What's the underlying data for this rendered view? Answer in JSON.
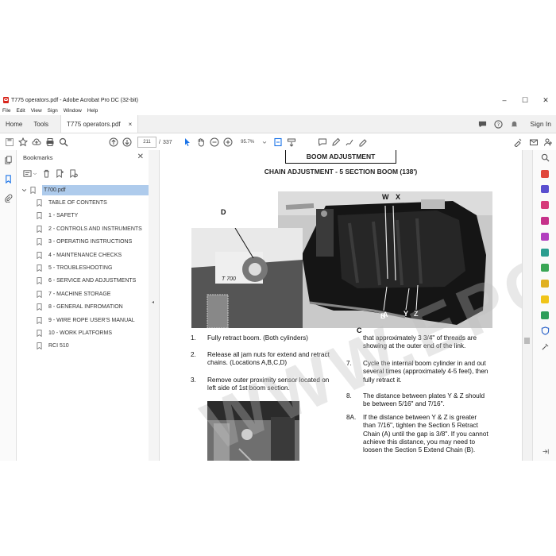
{
  "window": {
    "title": "T775 operators.pdf - Adobe Acrobat Pro DC (32-bit)",
    "controls": [
      "–",
      "☐",
      "✕"
    ]
  },
  "menu": [
    "File",
    "Edit",
    "View",
    "Sign",
    "Window",
    "Help"
  ],
  "tabs": {
    "home": "Home",
    "tools": "Tools",
    "doc": "T775 operators.pdf",
    "doc_close": "×",
    "signin": "Sign In"
  },
  "toolbar": {
    "page_current": "211",
    "page_sep": "/",
    "page_total": "337",
    "zoom": "95.7%"
  },
  "bookmarks": {
    "title": "Bookmarks",
    "close": "✕",
    "root": "T700.pdf",
    "items": [
      "TABLE OF CONTENTS",
      "1 - SAFETY",
      "2 - CONTROLS AND INSTRUMENTS",
      "3 - OPERATING INSTRUCTIONS",
      "4 - MAINTENANCE CHECKS",
      "5 - TROUBLESHOOTING",
      "6 - SERVICE AND ADJUSTMENTS",
      "7 - MACHINE STORAGE",
      "8 - GENERAL INFROMATION",
      "9 - WIRE ROPE USER'S MANUAL",
      "10 - WORK PLATFORMS",
      "RCI 510"
    ]
  },
  "page": {
    "header": "BOOM ADJUSTMENT",
    "subtitle": "CHAIN ADJUSTMENT - 5 SECTION BOOM (138')",
    "labels": {
      "d": "D",
      "w": "W",
      "x": "X",
      "a": "A",
      "b": "B",
      "c": "C",
      "y": "Y",
      "z": "Z"
    },
    "photo_text": "T 700",
    "steps_left": [
      {
        "num": "1.",
        "text": "Fully retract boom. (Both cylinders)"
      },
      {
        "num": "2.",
        "text": "Release all jam nuts for extend and retract chains. (Locations A,B,C,D)"
      },
      {
        "num": "3.",
        "text": "Remove outer proximity sensor located on left side of 1st boom section."
      }
    ],
    "cont_right": "that approximately 3 3/4\" of threads are showing at the outer end of the link.",
    "steps_right": [
      {
        "num": "7.",
        "text": "Cycle the internal boom cylinder in and out several times (approximately 4-5 feet), then fully retract it."
      },
      {
        "num": "8.",
        "text": "The distance between plates Y & Z should be between 5/16\" and 7/16\"."
      },
      {
        "num": "8A.",
        "text": "If the distance between Y & Z is greater than 7/16\", tighten the Section 5 Retract Chain (A) until the gap is 3/8\". If you cannot achieve this distance, you may need to loosen the Section 5 Extend Chain (B)."
      }
    ]
  },
  "watermark": "WWW.EPCBPD.COM"
}
